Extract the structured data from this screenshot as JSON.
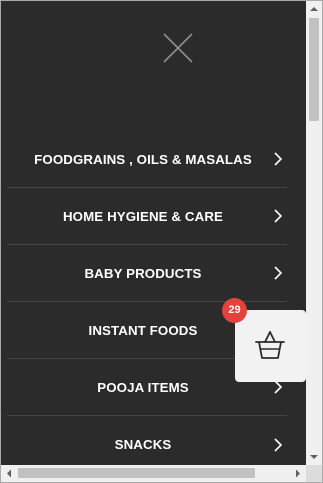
{
  "menu": {
    "close_icon": "close-icon",
    "items": [
      {
        "label": "FOODGRAINS , OILS & MASALAS",
        "icon": "chevron-right-icon"
      },
      {
        "label": "HOME HYGIENE & CARE",
        "icon": "chevron-right-icon"
      },
      {
        "label": "BABY PRODUCTS",
        "icon": "chevron-right-icon"
      },
      {
        "label": "INSTANT FOODS",
        "icon": "chevron-right-icon"
      },
      {
        "label": "POOJA ITEMS",
        "icon": "chevron-right-icon"
      },
      {
        "label": "SNACKS",
        "icon": "chevron-right-icon"
      }
    ]
  },
  "cart": {
    "icon": "basket-icon",
    "count": "29",
    "badge_color": "#e4433d"
  },
  "colors": {
    "panel_background": "#2b2b2b",
    "menu_text": "#ffffff",
    "cart_background": "#f2f2f2"
  }
}
